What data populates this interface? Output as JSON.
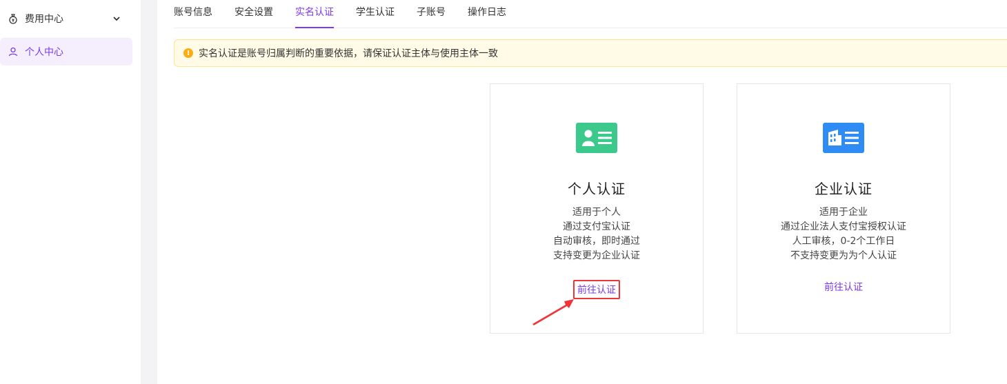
{
  "sidebar": {
    "items": [
      {
        "label": "费用中心",
        "icon": "money-bag-icon"
      },
      {
        "label": "个人中心",
        "icon": "user-icon"
      }
    ]
  },
  "tabs": [
    "账号信息",
    "安全设置",
    "实名认证",
    "学生认证",
    "子账号",
    "操作日志"
  ],
  "active_tab": "实名认证",
  "notice": {
    "text": "实名认证是账号归属判断的重要依据，请保证认证主体与使用主体一致",
    "icon": "warning-icon"
  },
  "cards": {
    "personal": {
      "title": "个人认证",
      "icon": "id-card-icon",
      "lines": [
        "适用于个人",
        "通过支付宝认证",
        "自动审核，即时通过",
        "支持变更为企业认证"
      ],
      "action": "前往认证",
      "color": "#3cc98c"
    },
    "enterprise": {
      "title": "企业认证",
      "icon": "building-card-icon",
      "lines": [
        "适用于企业",
        "通过企业法人支付宝授权认证",
        "人工审核，0-2个工作日",
        "不支持变更为为个人认证"
      ],
      "action": "前往认证",
      "color": "#2f8cf5"
    }
  },
  "accent": "#7c3aed",
  "highlight": "#f0353a"
}
